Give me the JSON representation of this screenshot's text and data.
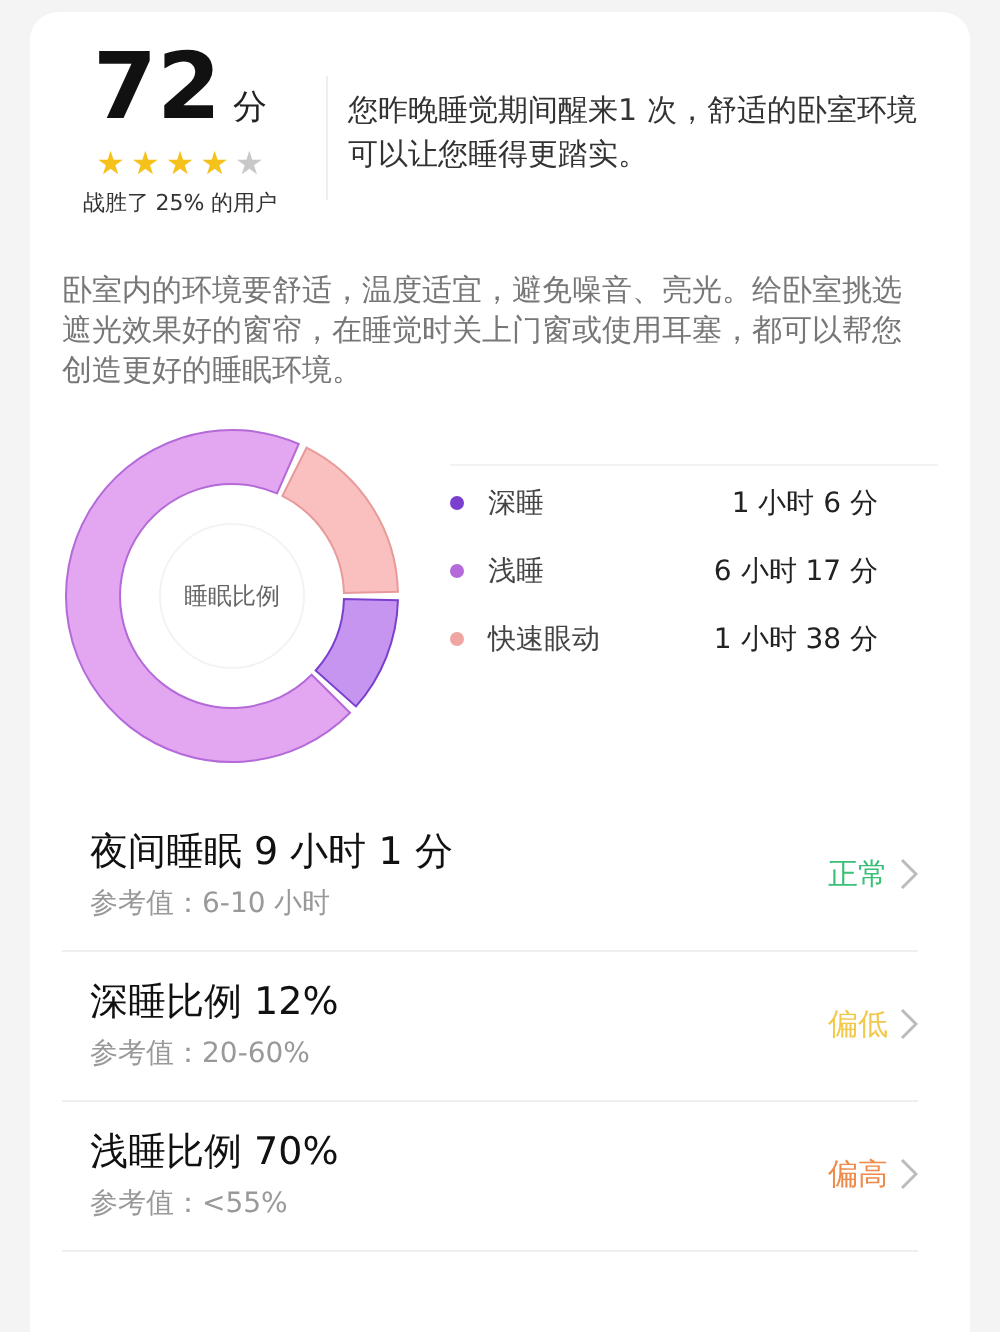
{
  "score": {
    "value": "72",
    "unit": "分",
    "stars": 4,
    "beat": "战胜了 25% 的用户"
  },
  "summary": "您昨晚睡觉期间醒来1 次，舒适的卧室环境可以让您睡得更踏实。",
  "advice": "卧室内的环境要舒适，温度适宜，避免噪音、亮光。给卧室挑选遮光效果好的窗帘，在睡觉时关上门窗或使用耳塞，都可以帮您创造更好的睡眠环境。",
  "sleep_chart": {
    "legend": [
      {
        "duration": "1 小时 6 分",
        "color": "#7a3fcf"
      },
      {
        "duration": "6 小时 17 分",
        "color": "#b46ad8"
      },
      {
        "duration": "1 小时 38 分",
        "color": "#f0a5a0"
      }
    ],
    "chart_data": {
      "type": "donut",
      "categories": [
        "深睡",
        "浅睡",
        "快速眼动"
      ],
      "series": [
        {
          "name": "睡眠比例",
          "values": [
            12,
            70,
            18
          ]
        }
      ]
    }
  },
  "metrics": [
    {
      "title": "夜间睡眠 9 小时 1 分",
      "reference": "参考值：6-10 小时",
      "status": "正常",
      "color": "#3cbf7a"
    },
    {
      "title": "深睡比例 12%",
      "reference": "参考值：20-60%",
      "status": "偏低",
      "color": "#f2c94c"
    },
    {
      "title": "浅睡比例 70%",
      "reference": "参考值：<55%",
      "status": "偏高",
      "color": "#ee8a4a"
    }
  ]
}
